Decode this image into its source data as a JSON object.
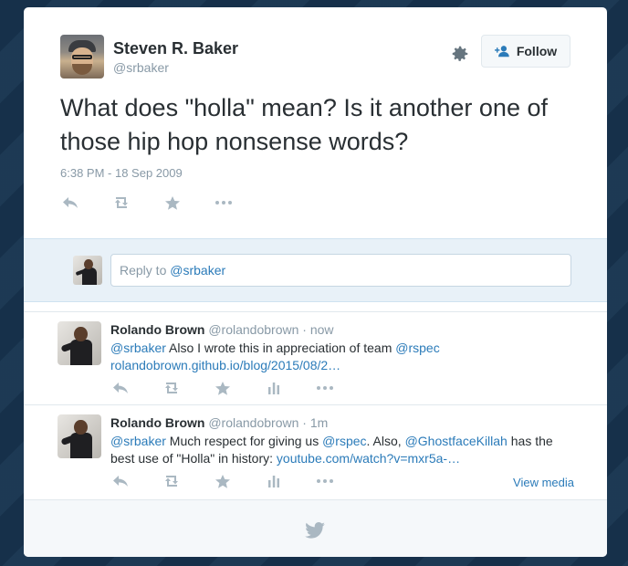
{
  "tweet": {
    "author_name": "Steven R. Baker",
    "author_handle": "@srbaker",
    "follow_label": "Follow",
    "text": "What does \"holla\" mean? Is it another one of those hip hop nonsense words?",
    "timestamp": "6:38 PM - 18 Sep 2009"
  },
  "reply_box": {
    "prefix": "Reply to ",
    "mention": "@srbaker"
  },
  "replies": [
    {
      "name": "Rolando Brown",
      "handle": "@rolandobrown",
      "separator": " · ",
      "time": "now",
      "text_parts": [
        "@srbaker",
        " Also I wrote this in appreciation of team ",
        "@rspec",
        "",
        "rolandobrown.github.io/blog/2015/08/2…"
      ]
    },
    {
      "name": "Rolando Brown",
      "handle": "@rolandobrown",
      "separator": " · ",
      "time": "1m",
      "text_parts": [
        "@srbaker",
        " Much respect for giving us ",
        "@rspec",
        ".  Also, ",
        "@GhostfaceKillah",
        " has the best use of \"Holla\" in history: ",
        "youtube.com/watch?v=mxr5a-…"
      ],
      "view_media": "View media"
    }
  ],
  "icons": [
    "gear-icon",
    "add-user-icon",
    "reply-icon",
    "retweet-icon",
    "favorite-icon",
    "more-icon",
    "analytics-icon",
    "twitter-bird-icon"
  ],
  "colors": {
    "link": "#2b7bb9",
    "muted": "#8899a6",
    "text": "#292f33",
    "reply_bg": "#e8f1f8"
  }
}
